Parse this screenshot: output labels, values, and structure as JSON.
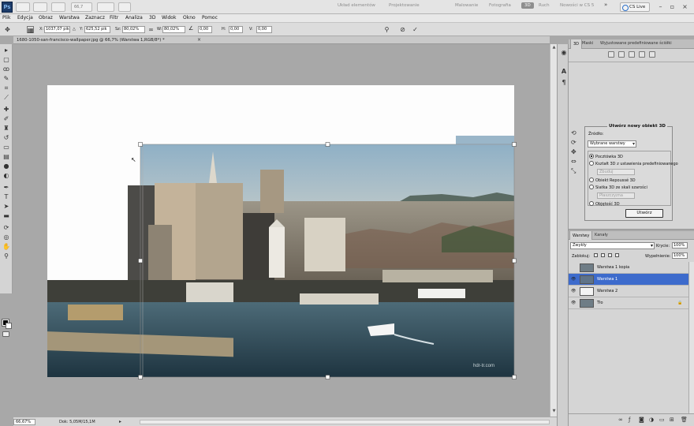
{
  "app": {
    "logo": "Ps",
    "workspaces": [
      "Układ elementów",
      "Projektowanie",
      "Malowanie",
      "Fotografia",
      "3D",
      "Ruch",
      "Nowości w CS 5"
    ],
    "active_workspace": "3D",
    "more": "»",
    "cslive": "CS Live",
    "zoom": "66,7"
  },
  "menu": [
    "Plik",
    "Edycja",
    "Obraz",
    "Warstwa",
    "Zaznacz",
    "Filtr",
    "Analiza",
    "3D",
    "Widok",
    "Okno",
    "Pomoc"
  ],
  "options": {
    "x_label": "X:",
    "x_value": "1037,07 pik",
    "y_label": "Y:",
    "y_value": "625,52 pik",
    "w_label": "Sz:",
    "w_value": "80,02%",
    "h_label": "W:",
    "h_value": "80,02%",
    "angle_value": "0,00",
    "hskew_label": "H:",
    "hskew_value": "0,00",
    "vskew_label": "V:",
    "vskew_value": "0,00"
  },
  "document": {
    "tab_title": "1680-1050-san-francisco-wallpaper.jpg @ 66,7% (Warstwa 1,RGB/8*) *",
    "close": "×"
  },
  "status": {
    "zoom": "66,67%",
    "doc": "Dok: 5,05M/15,1M"
  },
  "panel3d": {
    "tabs": [
      "3D",
      "Maski",
      "Wyjustowane predefiniowane ściółki"
    ],
    "new_object": {
      "title": "Utwórz nowy obiekt 3D",
      "source_label": "Źródło:",
      "source_value": "Wybrane warstwy",
      "options": [
        "Pocztówka 3D",
        "Kształt 3D z ustawienia predefiniowanego",
        "Obiekt Repoussé 3D",
        "Siatka 3D ze skali szarości",
        "Objętość 3D"
      ],
      "selected": 0,
      "sel1": "Zbuduj",
      "sel2": "Płaszczyzna",
      "create": "Utwórz"
    }
  },
  "layers": {
    "tabs": [
      "Warstwy",
      "Kanały"
    ],
    "blend_mode": "Zwykły",
    "opacity_label": "Krycie:",
    "opacity_value": "100%",
    "lock_label": "Zablokuj:",
    "fill_label": "Wypełnienie:",
    "fill_value": "100%",
    "items": [
      {
        "name": "Warstwa 1 kopia",
        "visible": false,
        "selected": false
      },
      {
        "name": "Warstwa 1",
        "visible": true,
        "selected": true
      },
      {
        "name": "Warstwa 2",
        "visible": true,
        "selected": false
      },
      {
        "name": "Tło",
        "visible": true,
        "selected": false
      }
    ]
  },
  "photo": {
    "watermark": "hdr-tr.com"
  }
}
